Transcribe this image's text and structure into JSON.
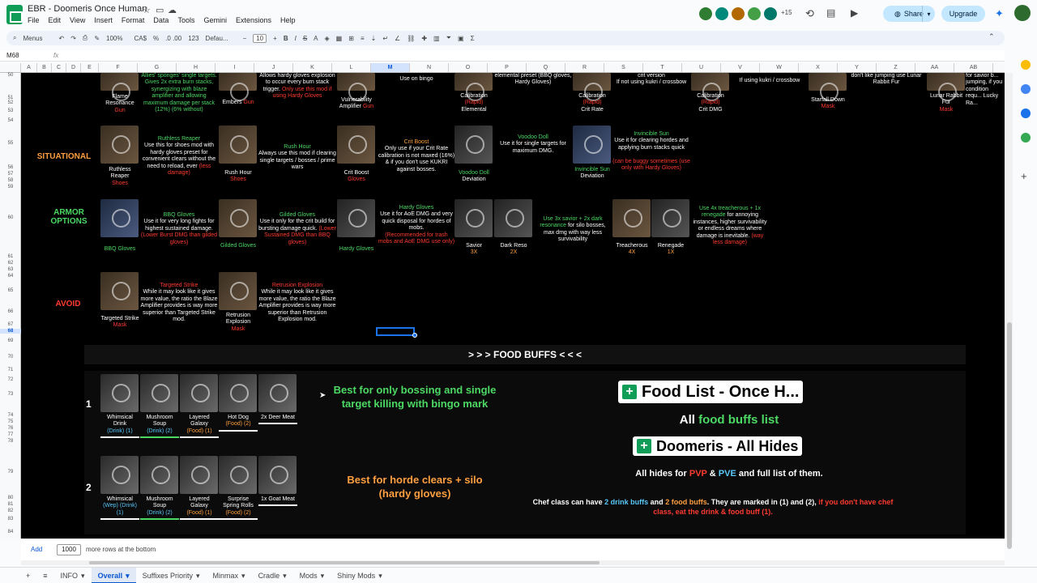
{
  "doc": {
    "title": "EBR - Doomeris Once Human",
    "collab_count": "+15",
    "share_label": "Share",
    "upgrade_label": "Upgrade"
  },
  "menus": [
    "File",
    "Edit",
    "View",
    "Insert",
    "Format",
    "Data",
    "Tools",
    "Gemini",
    "Extensions",
    "Help"
  ],
  "toolbar": {
    "menus_label": "Menus",
    "zoom": "100%",
    "currency": "CA$",
    "percent": "%",
    "decimals": ".0  .00",
    "numfmt": "123",
    "font": "Defau...",
    "size": "10"
  },
  "formula": {
    "cell_ref": "M68",
    "fx": "fx",
    "value": ""
  },
  "columns": [
    "A",
    "B",
    "C",
    "D",
    "E",
    "F",
    "G",
    "H",
    "I",
    "J",
    "K",
    "L",
    "M",
    "N",
    "O",
    "P",
    "Q",
    "R",
    "S",
    "T",
    "U",
    "V",
    "W",
    "X",
    "Y",
    "Z",
    "AA",
    "AB"
  ],
  "rows": [
    "50",
    "51",
    "52",
    "53",
    "54",
    "55",
    "56",
    "57",
    "58",
    "59",
    "60",
    "61",
    "62",
    "63",
    "64",
    "65",
    "66",
    "67",
    "68",
    "69",
    "70",
    "71",
    "72",
    "73",
    "74",
    "75",
    "76",
    "77",
    "78",
    "79",
    "80",
    "81",
    "82",
    "83",
    "84"
  ],
  "top_row": {
    "flame_top": "Allies' sponges' single targets. Gives 2x extra burn stacks, synergizing with blaze amplifier and allowing maximum damage per stack (12%) (6% without)",
    "embers_top": "Allows hardy gloves explosion to occur every burn stack trigger.",
    "embers_only": "Only use this mod if using Hardy Gloves",
    "bingo_top": "Use on bingo",
    "flame_name": "Flame Resonance",
    "flame_slot": "Gun",
    "embers_name": "Embers",
    "embers_slot": "Gun",
    "vuln_name": "Vulnerability Amplifier",
    "vuln_slot": "Gun",
    "cal1_name": "Calibration",
    "cal1_sub": "Elemental",
    "cal1_slot": "(Rapid)",
    "elem_preset": "elemental preset (BBQ gloves, Hardy Gloves)",
    "cal2_name": "Calibration",
    "cal2_sub": "Crit Rate",
    "cal2_slot": "(Rapid)",
    "crit_version": "crit version",
    "kukri_note1": "If not using kukri / crossbow",
    "cal3_name": "Calibration",
    "cal3_sub": "Crit DMG",
    "cal3_slot": "(Rapid)",
    "kukri_note2": "If using kukri / crossbow",
    "starfall_name": "Starfall Down",
    "starfall_slot": "Mask",
    "lunar_note": "don't like jumping use Lunar Rabbit Fur",
    "lunar_name": "Lunar Rabbit Fur",
    "lunar_slot": "Mask",
    "lucky_note": "for savior b... jumping, if you condition requ... Lucky Ra..."
  },
  "situational": {
    "label": "SITUATIONAL",
    "ruth_title": "Ruthless Reaper",
    "ruth_desc": "Use this for shoes mod with hardy gloves preset for convenient clears without the need to reload, ever",
    "ruth_red": "(less damage)",
    "ruth_name": "Ruthless Reaper",
    "ruth_slot": "Shoes",
    "rush_title": "Rush Hour",
    "rush_desc": "Always use this mod if clearing single targets / bosses / prime wars",
    "rush_name": "Rush Hour",
    "rush_slot": "Shoes",
    "critb_title": "Crit Boost",
    "critb_desc": "Only use if your Crit Rate calibration is not maxed (16%) & if you don't use KUKRI against bosses.",
    "critb_name": "Crit Boost",
    "critb_slot": "Gloves",
    "voodoo_title": "Voodoo Doll",
    "voodoo_desc": "Use it for single targets for maximum DMG.",
    "voodoo_name": "Voodoo Doll",
    "voodoo_sub": "Deviation",
    "sun_title": "Invincible Sun",
    "sun_desc": "Use it for clearing hordes and applying burn stacks quick",
    "sun_red": "(can be buggy sometimes (use only with Hardy Gloves)",
    "sun_name": "Invincible Sun",
    "sun_sub": "Deviation"
  },
  "armor": {
    "label": "ARMOR OPTIONS",
    "bbq_title": "BBQ Gloves",
    "bbq_desc": "Use it for very long fights for highest sustained damage.",
    "bbq_red": "(Lower Burst DMG than gilded gloves)",
    "bbq_name": "BBQ Gloves",
    "gild_title": "Gilded Gloves",
    "gild_desc": "Use it only for the crit build for bursting damage quick.",
    "gild_red": "(Lower Sustained DMG than BBQ gloves)",
    "gild_name": "Gilded Gloves",
    "hardy_name": "Hardy Gloves",
    "hardy_title": "Hardy Gloves",
    "hardy_desc": "Use it for AoE DMG and very quick disposal for hordes of mobs.",
    "hardy_red": "(Recommended for trash mobs and AoE DMG use only)",
    "savior_name": "Savior",
    "savior_count": "3X",
    "dark_name": "Dark Reso",
    "dark_count": "2X",
    "use3x_green": "Use 3x savior + 2x dark resonance",
    "use3x_white": "for silo bosses, max dmg with way less survivability",
    "treach_name": "Treacherous",
    "treach_count": "4X",
    "reneg_name": "Renegade",
    "reneg_count": "1X",
    "use4x_green": "Use 4x treacherous + 1x renegade",
    "use4x_white": "for annoying instances, higher survivability or endless dreams where damage is inevitable.",
    "use4x_red": "(way less damage)"
  },
  "avoid": {
    "label": "AVOID",
    "targ_title": "Targeted Strike",
    "targ_desc": "While it may look like it gives more value, the ratio the Blaze Amplifier provides is way more superior than Targeted Strike mod.",
    "targ_name": "Targeted Strike",
    "targ_slot": "Mask",
    "retr_title": "Retrusion Explosion",
    "retr_desc": "While it may look like it gives more value, the ratio the Blaze Amplifier provides is way more superior than Retrusion Explosion mod.",
    "retr_name": "Retrusion Explosion",
    "retr_slot": "Mask"
  },
  "food": {
    "header": "> > > FOOD BUFFS < < <",
    "row1_num": "1",
    "row2_num": "2",
    "r1": [
      {
        "name": "Whimsical Drink",
        "tag": "(Drink) (1)"
      },
      {
        "name": "Mushroom Soup",
        "tag": "(Drink) (2)"
      },
      {
        "name": "Layered Galaxy",
        "tag": "(Food) (1)"
      },
      {
        "name": "Hot Dog",
        "tag": "(Food) (2)"
      },
      {
        "name": "2x Deer Meat",
        "tag": ""
      }
    ],
    "r2": [
      {
        "name": "Whimsical",
        "tag": "(Wep) (Drink)(1)"
      },
      {
        "name": "Mushroom Soup",
        "tag": "(Drink) (2)"
      },
      {
        "name": "Layered Galaxy",
        "tag": "(Food) (1)"
      },
      {
        "name": "Surprise Spring Rolls",
        "tag": "(Food) (2)"
      },
      {
        "name": "1x Goat Meat",
        "tag": ""
      }
    ],
    "r1_best": "Best for only bossing and single target killing with bingo mark",
    "r2_best": "Best for horde clears + silo (hardy gloves)",
    "link1": "Food List - Once H...",
    "all_food_prefix": "All",
    "all_food_green": "food buffs list",
    "link2": "Doomeris - All Hides",
    "hides_prefix": "All hides for",
    "hides_pvp": "PVP",
    "hides_and": "&",
    "hides_pve": "PVE",
    "hides_suffix": "and full list of them.",
    "chef_1": "Chef class can have",
    "chef_drinks": "2 drink buffs",
    "chef_and": "and",
    "chef_food": "2 food buffs",
    "chef_2": ". They are marked in (1) and (2),",
    "chef_red": "if you don't have chef class, eat the drink & food buff (1)."
  },
  "bottom": {
    "add_label": "Add",
    "rows_value": "1000",
    "rows_suffix": "more rows at the bottom"
  },
  "sheets": [
    "INFO",
    "Overall",
    "Suffixes Priority",
    "Minmax",
    "Cradle",
    "Mods",
    "Shiny Mods"
  ],
  "active_sheet": "Overall",
  "colors": {
    "green": "#4cd964",
    "red": "#ff3b30",
    "orange": "#ff9f40",
    "cyan": "#5ac8fa",
    "accent": "#0b57d0"
  }
}
